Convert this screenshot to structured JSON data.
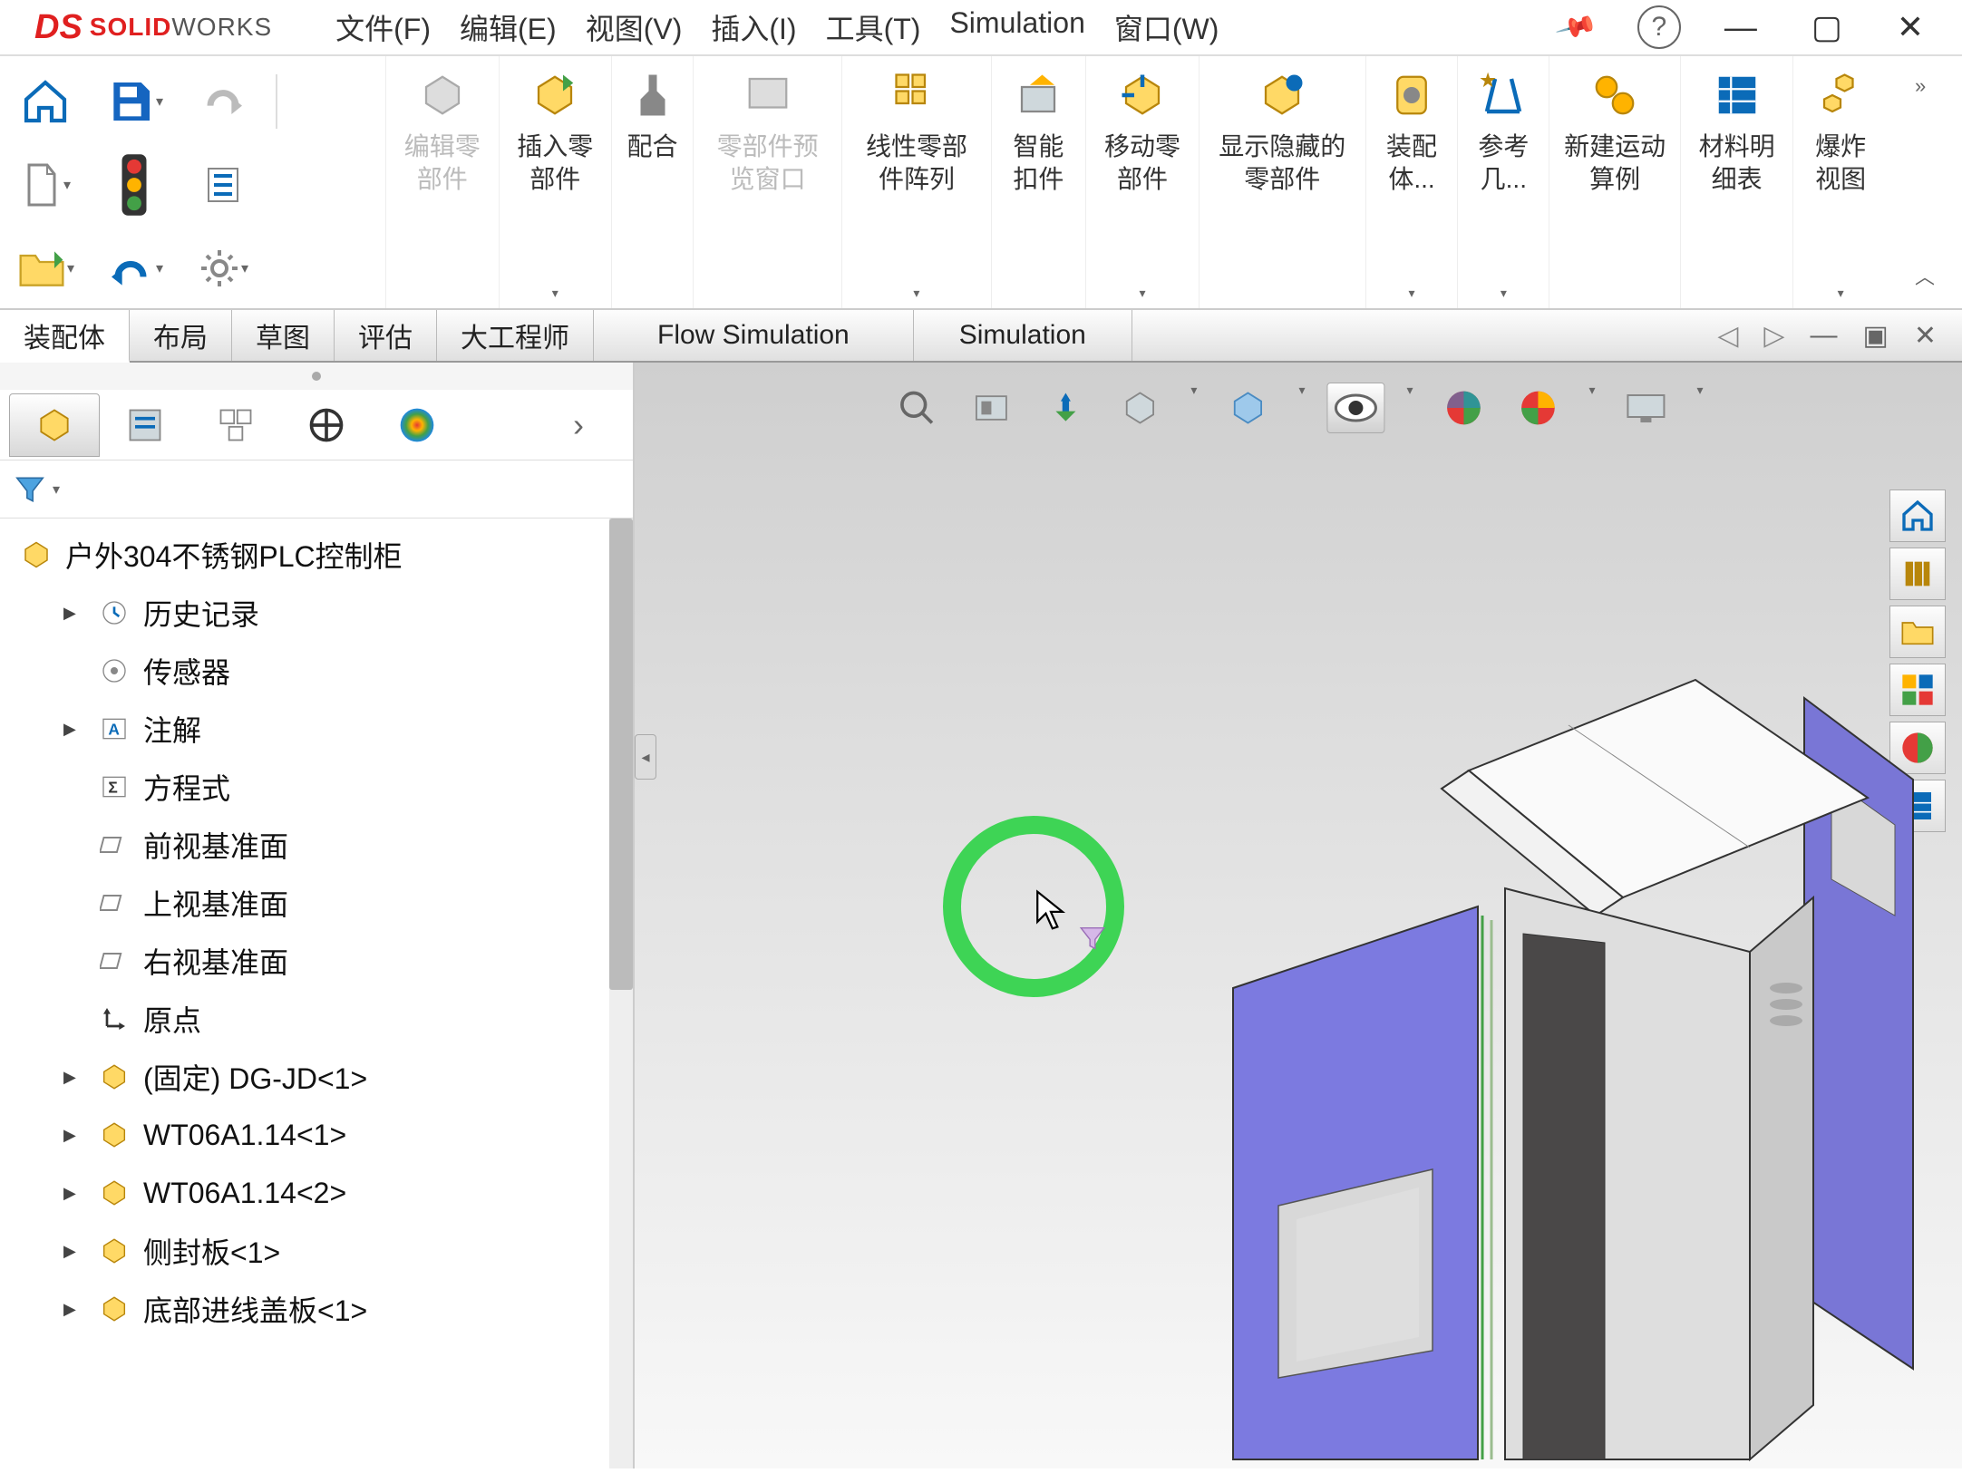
{
  "app": {
    "logo_solid": "SOLID",
    "logo_works": "WORKS"
  },
  "menu": {
    "file": "文件(F)",
    "edit": "编辑(E)",
    "view": "视图(V)",
    "insert": "插入(I)",
    "tools": "工具(T)",
    "simulation": "Simulation",
    "window": "窗口(W)"
  },
  "ribbon": {
    "edit_component": "编辑零部件",
    "insert_component": "插入零部件",
    "mate": "配合",
    "preview_window": "零部件预览窗口",
    "linear_pattern": "线性零部件阵列",
    "smart_fastener": "智能扣件",
    "move_component": "移动零部件",
    "show_hidden": "显示隐藏的零部件",
    "assembly": "装配体...",
    "reference": "参考几...",
    "motion_study": "新建运动算例",
    "bom": "材料明细表",
    "exploded": "爆炸视图"
  },
  "cmd_tabs": {
    "assembly": "装配体",
    "layout": "布局",
    "sketch": "草图",
    "evaluate": "评估",
    "engineer": "大工程师",
    "flow": "Flow Simulation",
    "sim": "Simulation"
  },
  "tree": {
    "root": "户外304不锈钢PLC控制柜",
    "history": "历史记录",
    "sensors": "传感器",
    "annotations": "注解",
    "equations": "方程式",
    "front_plane": "前视基准面",
    "top_plane": "上视基准面",
    "right_plane": "右视基准面",
    "origin": "原点",
    "part1": "(固定) DG-JD<1>",
    "part2": "WT06A1.14<1>",
    "part3": "WT06A1.14<2>",
    "part4": "侧封板<1>",
    "part5": "底部进线盖板<1>"
  }
}
